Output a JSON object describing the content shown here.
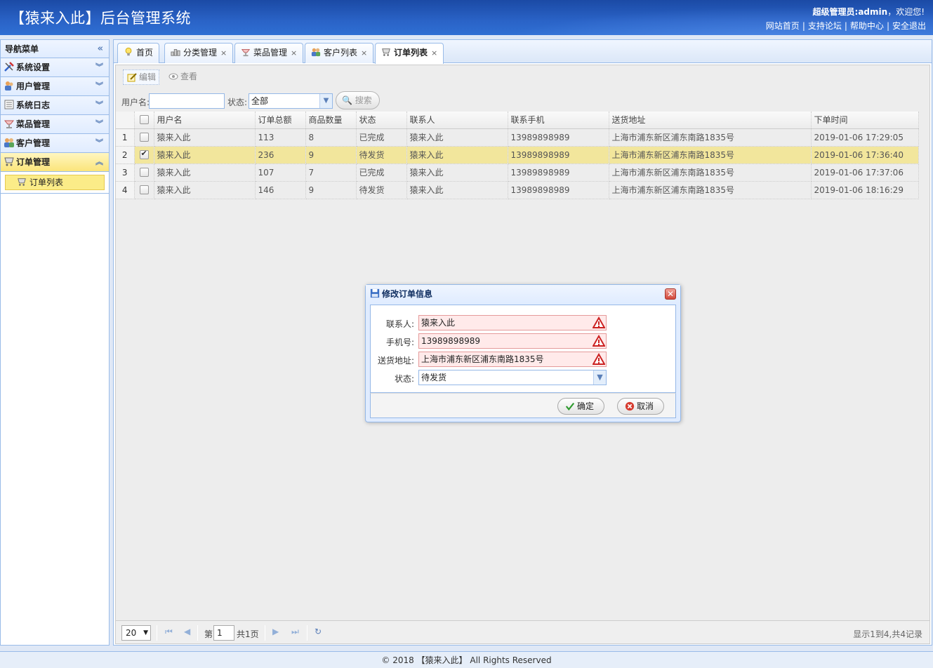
{
  "header": {
    "title": "【猿来入此】后台管理系统",
    "welcome_role": "超级管理员:admin",
    "welcome_suffix": "，欢迎您!",
    "links": [
      "网站首页",
      "支持论坛",
      "帮助中心",
      "安全退出"
    ]
  },
  "sidebar": {
    "title": "导航菜单",
    "groups": [
      {
        "label": "系统设置",
        "icon": "tools-icon"
      },
      {
        "label": "用户管理",
        "icon": "users-icon"
      },
      {
        "label": "系统日志",
        "icon": "log-icon"
      },
      {
        "label": "菜品管理",
        "icon": "dish-icon"
      },
      {
        "label": "客户管理",
        "icon": "customer-icon"
      },
      {
        "label": "订单管理",
        "icon": "order-icon"
      }
    ],
    "active_group": "订单管理",
    "active_item": "订单列表"
  },
  "tabs": [
    {
      "label": "首页",
      "closable": false
    },
    {
      "label": "分类管理",
      "closable": true
    },
    {
      "label": "菜品管理",
      "closable": true
    },
    {
      "label": "客户列表",
      "closable": true
    },
    {
      "label": "订单列表",
      "closable": true
    }
  ],
  "tab_close_glyph": "×",
  "toolbar": {
    "edit_label": "编辑",
    "view_label": "查看"
  },
  "search": {
    "username_label": "用户名:",
    "username_value": "",
    "status_label": "状态:",
    "status_value": "全部",
    "search_label": "搜索"
  },
  "grid": {
    "columns": [
      "用户名",
      "订单总额",
      "商品数量",
      "状态",
      "联系人",
      "联系手机",
      "送货地址",
      "下单时间"
    ],
    "rows": [
      {
        "no": "1",
        "checked": false,
        "user": "猿来入此",
        "total": "113",
        "qty": "8",
        "status": "已完成",
        "contact": "猿来入此",
        "phone": "13989898989",
        "address": "上海市浦东新区浦东南路1835号",
        "time": "2019-01-06 17:29:05"
      },
      {
        "no": "2",
        "checked": true,
        "user": "猿来入此",
        "total": "236",
        "qty": "9",
        "status": "待发货",
        "contact": "猿来入此",
        "phone": "13989898989",
        "address": "上海市浦东新区浦东南路1835号",
        "time": "2019-01-06 17:36:40"
      },
      {
        "no": "3",
        "checked": false,
        "user": "猿来入此",
        "total": "107",
        "qty": "7",
        "status": "已完成",
        "contact": "猿来入此",
        "phone": "13989898989",
        "address": "上海市浦东新区浦东南路1835号",
        "time": "2019-01-06 17:37:06"
      },
      {
        "no": "4",
        "checked": false,
        "user": "猿来入此",
        "total": "146",
        "qty": "9",
        "status": "待发货",
        "contact": "猿来入此",
        "phone": "13989898989",
        "address": "上海市浦东新区浦东南路1835号",
        "time": "2019-01-06 18:16:29"
      }
    ]
  },
  "pager": {
    "page_size": "20",
    "page_prefix": "第",
    "page_value": "1",
    "page_suffix": "共1页",
    "info": "显示1到4,共4记录"
  },
  "dialog": {
    "title": "修改订单信息",
    "close_glyph": "✕",
    "fields": [
      {
        "label": "联系人:",
        "value": "猿来入此"
      },
      {
        "label": "手机号:",
        "value": "13989898989"
      },
      {
        "label": "送货地址:",
        "value": "上海市浦东新区浦东南路1835号"
      }
    ],
    "status_label": "状态:",
    "status_value": "待发货",
    "ok_label": "确定",
    "cancel_label": "取消"
  },
  "footer": {
    "text": "© 2018 【猿来入此】 All Rights Reserved"
  },
  "colors": {
    "header": "#2a63c7",
    "selected_row": "#f2e69c",
    "active_menu": "#fbec88",
    "border": "#99bbe8"
  }
}
